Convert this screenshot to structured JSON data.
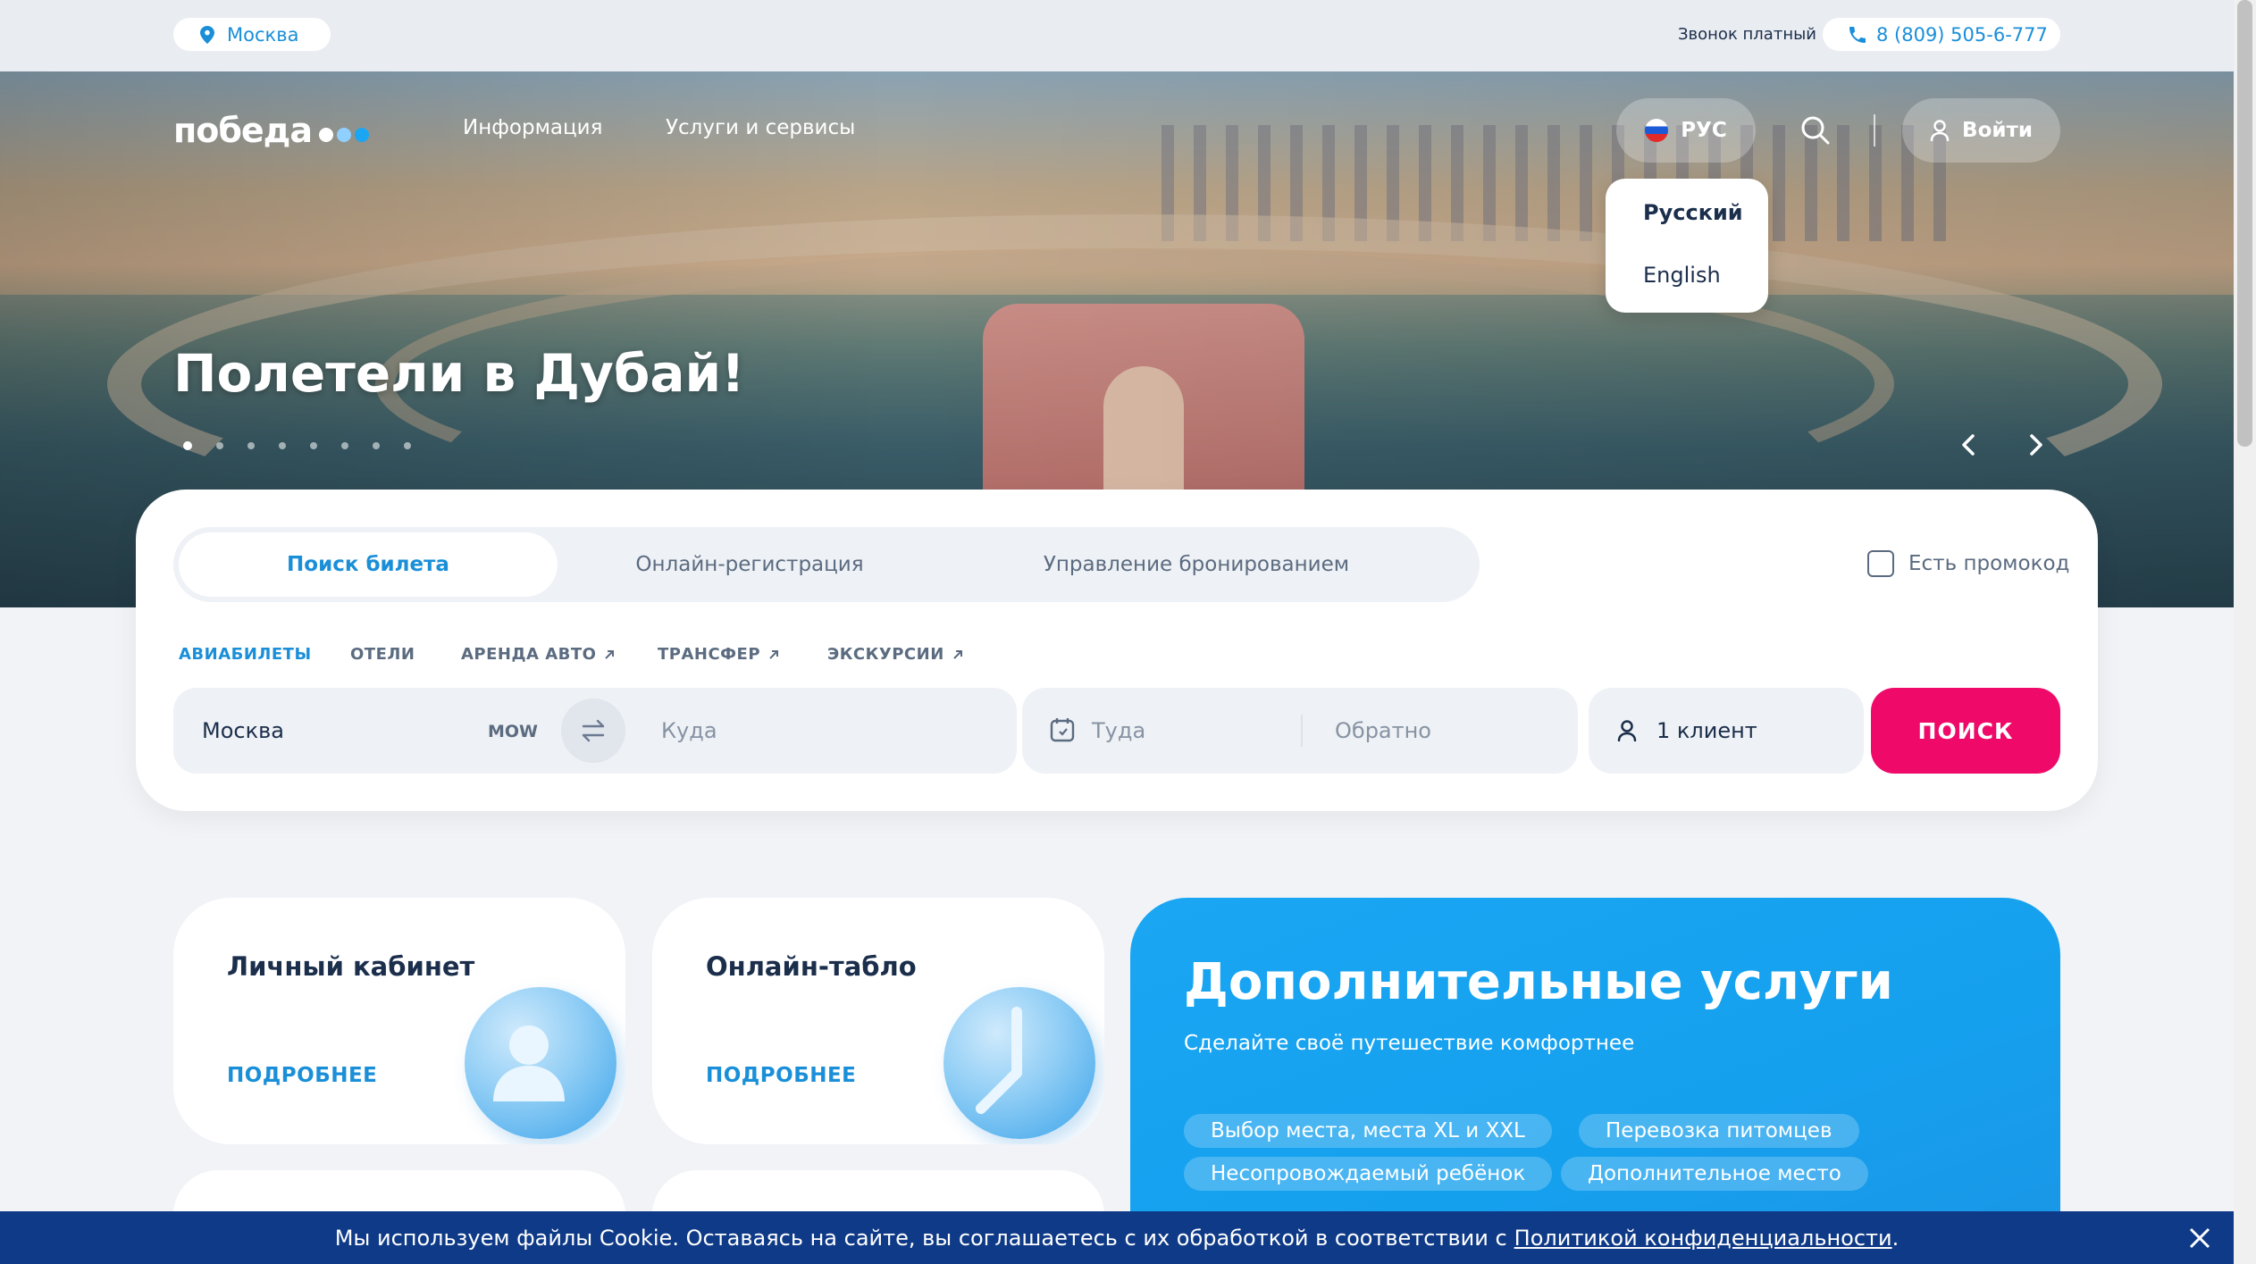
{
  "topbar": {
    "city": "Москва",
    "call_label": "Звонок платный",
    "phone": "8 (809) 505-6-777"
  },
  "header": {
    "logo": "победа",
    "logo_dot_colors": [
      "#ffffff",
      "#8fd0ff",
      "#1aa6f3"
    ],
    "nav": [
      "Информация",
      "Услуги и сервисы"
    ],
    "language": "РУС",
    "login": "Войти"
  },
  "lang_menu": {
    "options": [
      "Русский",
      "English"
    ],
    "selected": "Русский"
  },
  "hero": {
    "title": "Полетели в Дубай!",
    "slide_count": 8,
    "active_slide": 1
  },
  "search": {
    "tabs": [
      "Поиск билета",
      "Онлайн-регистрация",
      "Управление бронированием"
    ],
    "active_tab": "Поиск билета",
    "promo_label": "Есть промокод",
    "subtabs": [
      "АВИАБИЛЕТЫ",
      "ОТЕЛИ",
      "АРЕНДА АВТО",
      "ТРАНСФЕР",
      "ЭКСКУРСИИ"
    ],
    "from_value": "Москва",
    "from_code": "MOW",
    "to_placeholder": "Куда",
    "depart_placeholder": "Туда",
    "return_placeholder": "Обратно",
    "passengers": "1 клиент",
    "search_button": "ПОИСК"
  },
  "cards": [
    {
      "title": "Личный кабинет",
      "link": "ПОДРОБНЕЕ",
      "icon": "user-icon"
    },
    {
      "title": "Онлайн-табло",
      "link": "ПОДРОБНЕЕ",
      "icon": "clock-icon"
    }
  ],
  "services": {
    "title": "Дополнительные услуги",
    "subtitle": "Сделайте своё путешествие комфортнее",
    "chips": [
      "Выбор места, места XL и XXL",
      "Перевозка питомцев",
      "Несопровождаемый ребёнок",
      "Дополнительное место"
    ]
  },
  "cookie": {
    "text": "Мы используем файлы Cookie. Оставаясь на сайте, вы соглашаетесь с их обработкой в соответствии с",
    "link": "Политикой конфиденциальности",
    "end": "."
  },
  "colors": {
    "accent": "#1a8fd8",
    "search_button": "#ef0a6a",
    "services_bg": "#1aa6f3",
    "cookie_bg": "#0f3a87"
  }
}
